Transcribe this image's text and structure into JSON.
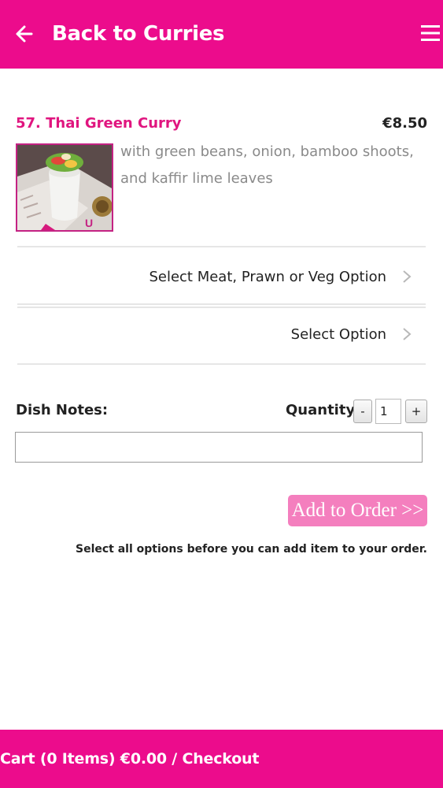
{
  "header": {
    "back_label": "Back to Curries",
    "back_icon": "arrow-left-icon",
    "menu_icon": "hamburger-menu-icon",
    "brand_color": "#ec0c8c"
  },
  "dish": {
    "title": "57. Thai Green Curry",
    "price": "€8.50",
    "description": "with green beans, onion, bamboo shoots, and kaffir lime leaves",
    "title_color": "#e0157f"
  },
  "options": [
    {
      "label": "Select Meat, Prawn or Veg Option",
      "icon": "chevron-right-icon"
    },
    {
      "label": "Select Option",
      "icon": "chevron-right-icon"
    }
  ],
  "order_form": {
    "notes_label": "Dish Notes:",
    "notes_value": "",
    "quantity_label": "Quantity:",
    "decrement_label": "-",
    "quantity_value": "1",
    "increment_label": "+",
    "add_button_label": "Add to Order >>",
    "add_button_color": "#f47fbe",
    "hint": "Select all options before you can add item to your order."
  },
  "footer": {
    "cart_label": "Cart (0 Items) €0.00 / Checkout"
  }
}
